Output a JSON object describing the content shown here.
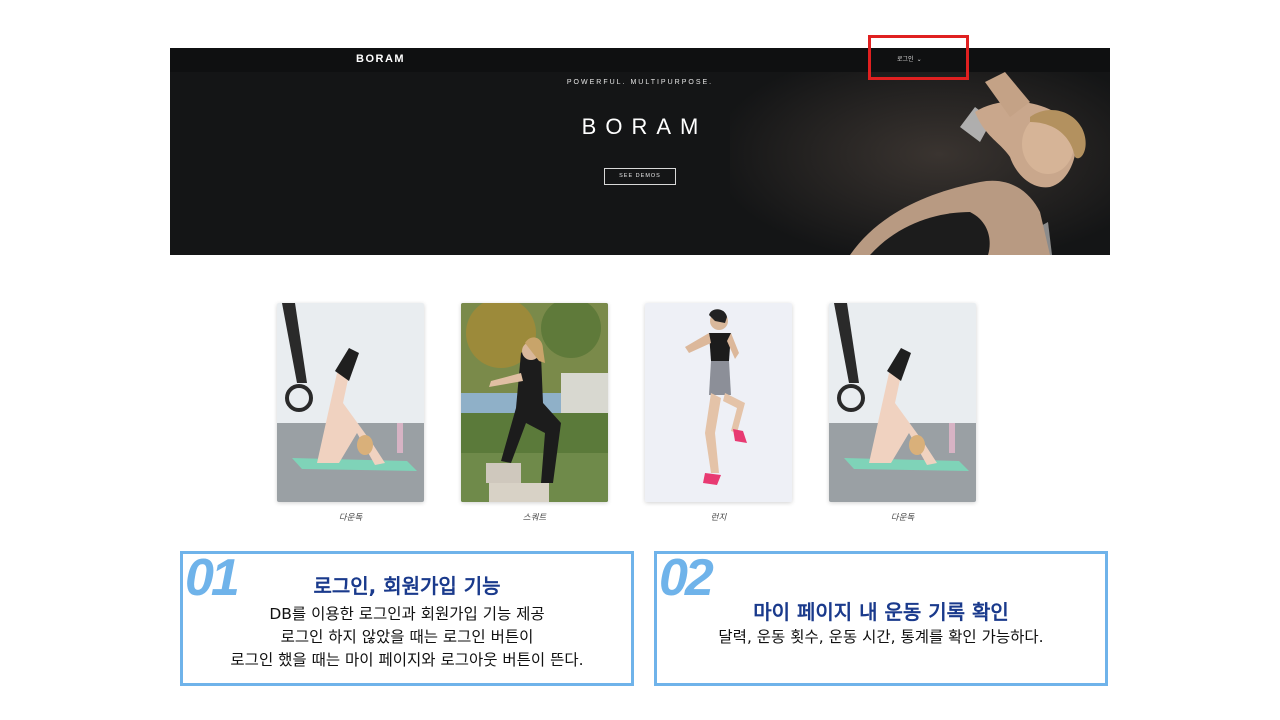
{
  "header": {
    "brand": "BORAM",
    "login_menu": "로그인",
    "login_caret": "⌄"
  },
  "hero": {
    "tagline": "POWERFUL. MULTIPURPOSE.",
    "title": "BORAM",
    "demo_button": "SEE DEMOS"
  },
  "cards": [
    {
      "label": "다운독"
    },
    {
      "label": "스쿼트"
    },
    {
      "label": "런지"
    },
    {
      "label": "다운독"
    }
  ],
  "features": [
    {
      "number": "01",
      "title": "로그인, 회원가입 기능",
      "lines": [
        "DB를 이용한 로그인과 회원가입 기능 제공",
        "로그인 하지 않았을 때는 로그인 버튼이",
        "로그인 했을 때는 마이 페이지와 로그아웃 버튼이 뜬다."
      ]
    },
    {
      "number": "02",
      "title": "마이 페이지 내 운동 기록 확인",
      "lines": [
        "달력, 운동 횟수, 운동 시간, 통계를 확인 가능하다."
      ]
    }
  ],
  "colors": {
    "highlight": "#e02020",
    "feature_border": "#6fb3ea",
    "feature_title": "#1a3a8c",
    "hero_bg": "#141516"
  }
}
